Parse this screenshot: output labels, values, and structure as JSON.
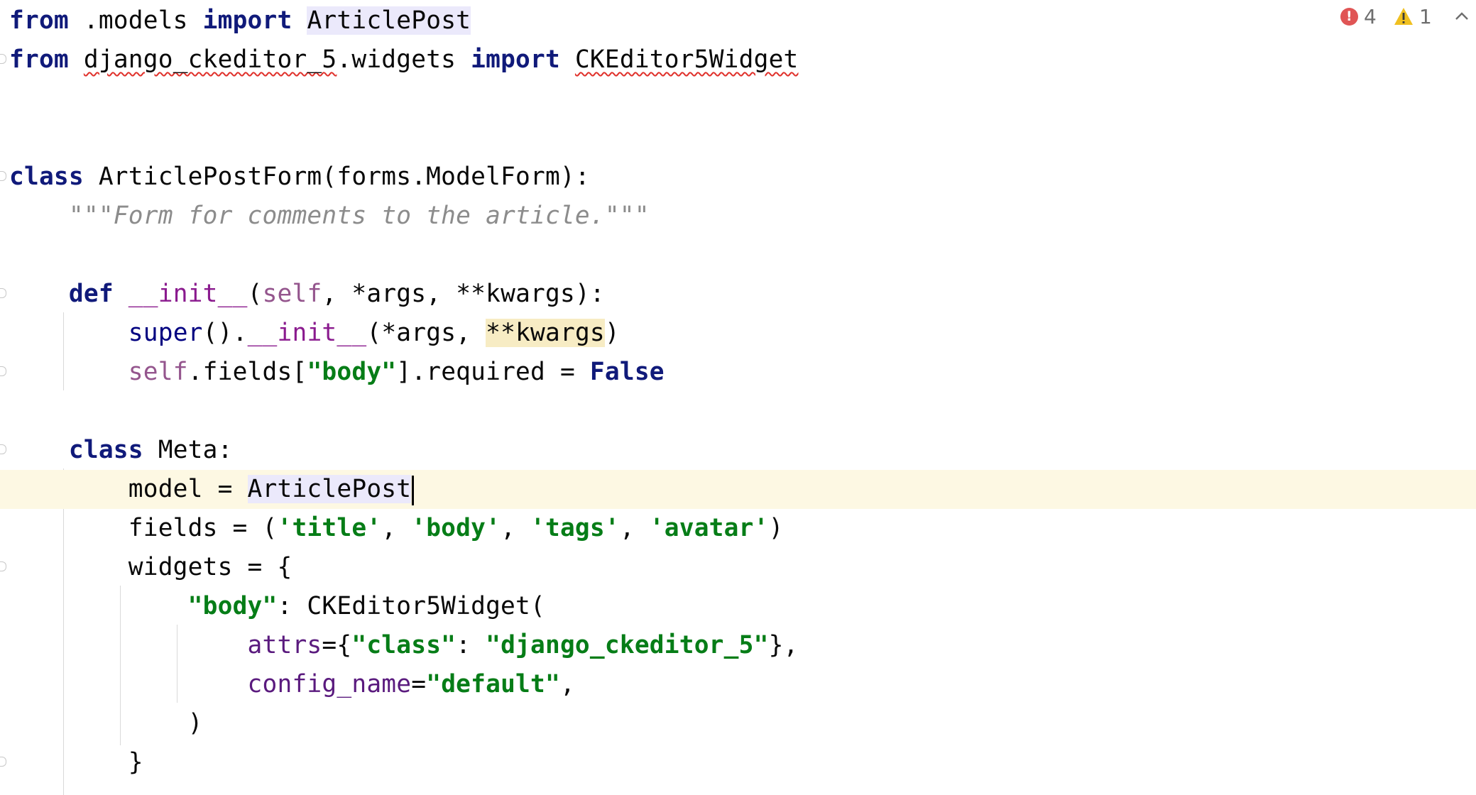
{
  "colors": {
    "keyword": "#101a7a",
    "string": "#067d17",
    "docstring": "#8c8c8c",
    "dunder": "#8a1a8e",
    "self": "#94558d",
    "named_param": "#5a1a7e",
    "current_line_bg": "#fdf8e3",
    "usage_highlight": "#ebe9fb",
    "kwargs_highlight": "#f7ecc4",
    "error": "#e05555",
    "warning": "#f0c020"
  },
  "inspections": {
    "errors_count": "4",
    "warnings_count": "1",
    "error_icon": "error-circle-icon",
    "warning_icon": "warning-triangle-icon",
    "nav_icon": "chevron-up-icon"
  },
  "code": {
    "l1": {
      "t1": "from",
      "t2": " .models ",
      "t3": "import",
      "t4": " ",
      "t5": "ArticlePost"
    },
    "l2": {
      "t1": "from",
      "t2": " ",
      "t3": "django_ckeditor_5",
      "t4": ".widgets ",
      "t5": "import",
      "t6": " ",
      "t7": "CKEditor5Widget"
    },
    "l5": {
      "t1": "class",
      "t2": " ArticlePostForm(forms.ModelForm):"
    },
    "l6": {
      "t1": "    ",
      "t2": "\"\"\"Form for comments to the article.\"\"\""
    },
    "l8": {
      "t1": "    ",
      "t2": "def",
      "t3": " ",
      "t4": "__init__",
      "t5": "(",
      "t6": "self",
      "t7": ", *args, **kwargs):"
    },
    "l9": {
      "t1": "        ",
      "t2": "super",
      "t3": "().",
      "t4": "__init__",
      "t5": "(*args, ",
      "t6": "**kwargs",
      "t7": ")"
    },
    "l10": {
      "t1": "        ",
      "t2": "self",
      "t3": ".fields[",
      "t4": "\"body\"",
      "t5": "].required = ",
      "t6": "False"
    },
    "l12": {
      "t1": "    ",
      "t2": "class",
      "t3": " Meta:"
    },
    "l13": {
      "t1": "        model = ",
      "t2": "ArticlePost"
    },
    "l14": {
      "t1": "        fields = (",
      "t2": "'title'",
      "t3": ", ",
      "t4": "'body'",
      "t5": ", ",
      "t6": "'tags'",
      "t7": ", ",
      "t8": "'avatar'",
      "t9": ")"
    },
    "l15": {
      "t1": "        widgets = {"
    },
    "l16": {
      "t1": "            ",
      "t2": "\"body\"",
      "t3": ": CKEditor5Widget("
    },
    "l17": {
      "t1": "                ",
      "t2": "attrs",
      "t3": "={",
      "t4": "\"class\"",
      "t5": ": ",
      "t6": "\"django_ckeditor_5\"",
      "t7": "},"
    },
    "l18": {
      "t1": "                ",
      "t2": "config_name",
      "t3": "=",
      "t4": "\"default\"",
      "t5": ","
    },
    "l19": {
      "t1": "            )"
    },
    "l20": {
      "t1": "        }"
    }
  }
}
